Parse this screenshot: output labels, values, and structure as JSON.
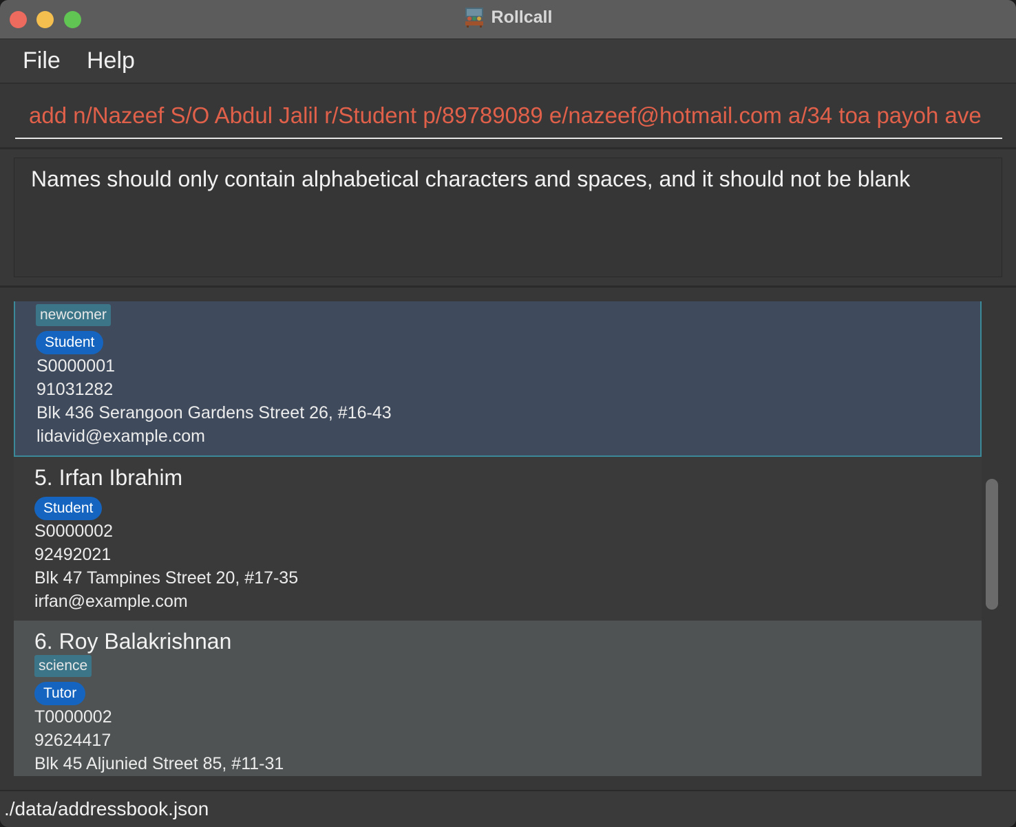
{
  "window": {
    "title": "Rollcall",
    "app_icon": "classroom-icon"
  },
  "menu": {
    "items": [
      "File",
      "Help"
    ]
  },
  "command": {
    "value": "add n/Nazeef S/O Abdul Jalil r/Student p/89789089 e/nazeef@hotmail.com a/34 toa payoh ave",
    "color": "#e0604a"
  },
  "result": {
    "message": "Names should only contain alphabetical characters and spaces, and it should not be blank"
  },
  "persons": [
    {
      "name": "",
      "tags": [
        "newcomer"
      ],
      "role": "Student",
      "id": "S0000001",
      "phone": "91031282",
      "address": "Blk 436 Serangoon Gardens Street 26, #16-43",
      "email": "lidavid@example.com",
      "selected": true
    },
    {
      "name": "5. Irfan Ibrahim",
      "tags": [],
      "role": "Student",
      "id": "S0000002",
      "phone": "92492021",
      "address": "Blk 47 Tampines Street 20, #17-35",
      "email": "irfan@example.com",
      "selected": false
    },
    {
      "name": "6. Roy Balakrishnan",
      "tags": [
        "science"
      ],
      "role": "Tutor",
      "id": "T0000002",
      "phone": "92624417",
      "address": "Blk 45 Aljunied Street 85, #11-31",
      "email": "",
      "selected": false
    }
  ],
  "colors": {
    "tag_bg": "#3c7587",
    "role_bg": "#1565c0",
    "selected_bg": "#3f4b5c",
    "selected_border": "#3a8a9a"
  },
  "status": {
    "file_path": "./data/addressbook.json"
  }
}
